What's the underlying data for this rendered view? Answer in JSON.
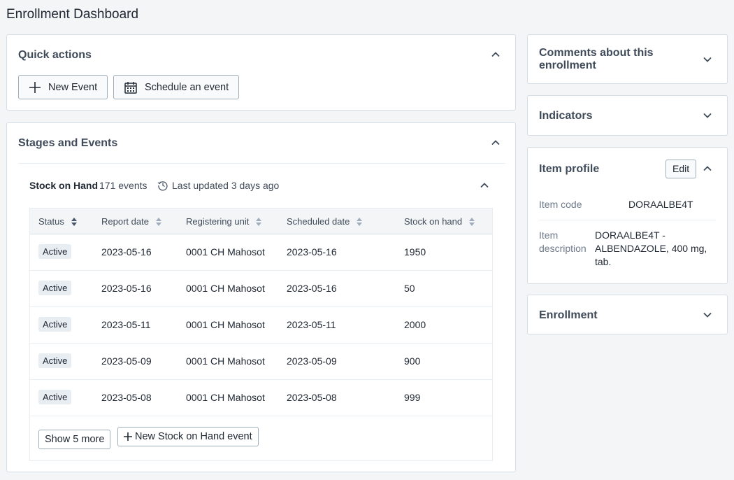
{
  "page": {
    "title": "Enrollment Dashboard"
  },
  "quick_actions": {
    "title": "Quick actions",
    "new_event_label": "New Event",
    "schedule_label": "Schedule an event"
  },
  "stages": {
    "title": "Stages and Events",
    "stage_name": "Stock on Hand",
    "event_count": "171 events",
    "last_updated": "Last updated 3 days ago",
    "columns": [
      "Status",
      "Report date",
      "Registering unit",
      "Scheduled date",
      "Stock on hand"
    ],
    "rows": [
      {
        "status": "Active",
        "report_date": "2023-05-16",
        "unit": "0001 CH Mahosot",
        "scheduled": "2023-05-16",
        "stock": "1950"
      },
      {
        "status": "Active",
        "report_date": "2023-05-16",
        "unit": "0001 CH Mahosot",
        "scheduled": "2023-05-16",
        "stock": "50"
      },
      {
        "status": "Active",
        "report_date": "2023-05-11",
        "unit": "0001 CH Mahosot",
        "scheduled": "2023-05-11",
        "stock": "2000"
      },
      {
        "status": "Active",
        "report_date": "2023-05-09",
        "unit": "0001 CH Mahosot",
        "scheduled": "2023-05-09",
        "stock": "900"
      },
      {
        "status": "Active",
        "report_date": "2023-05-08",
        "unit": "0001 CH Mahosot",
        "scheduled": "2023-05-08",
        "stock": "999"
      }
    ],
    "show_more_label": "Show 5 more",
    "new_stage_event_label": "New Stock on Hand event"
  },
  "right_panel": {
    "comments_title": "Comments about this enrollment",
    "indicators_title": "Indicators",
    "item_profile": {
      "title": "Item profile",
      "edit_label": "Edit",
      "code_label": "Item code",
      "code_value": "DORAALBE4T",
      "desc_label": "Item description",
      "desc_value": "DORAALBE4T - ALBENDAZOLE, 400 mg, tab."
    },
    "enrollment_title": "Enrollment"
  },
  "icons": {
    "add": "plus-icon",
    "calendar": "calendar-icon",
    "history": "history-icon",
    "sort": "sort-icon",
    "expand": "chevron-down-icon",
    "collapse": "chevron-up-icon"
  },
  "colors": {
    "background": "#f3f5f7",
    "card_border": "#d5dde5",
    "text": "#212934",
    "muted": "#6e7a8a",
    "sort_active": "#4a5768"
  }
}
